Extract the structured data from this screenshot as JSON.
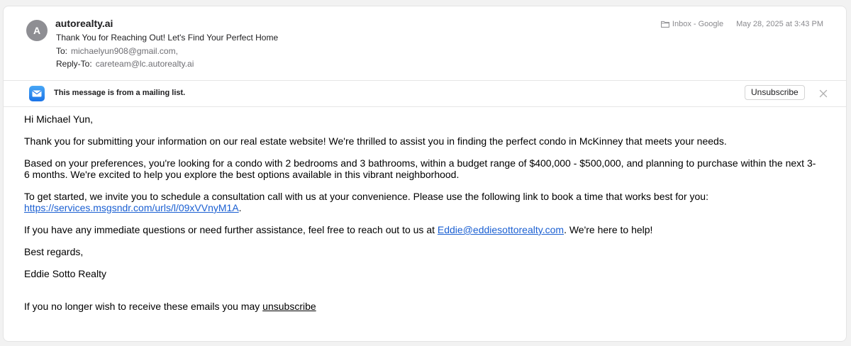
{
  "header": {
    "avatar_initial": "A",
    "sender": "autorealty.ai",
    "subject": "Thank You for Reaching Out! Let's Find Your Perfect Home",
    "to_label": "To:",
    "to_value": "michaelyun908@gmail.com,",
    "replyto_label": "Reply-To:",
    "replyto_value": "careteam@lc.autorealty.ai",
    "folder": "Inbox - Google",
    "date": "May 28, 2025 at 3:43 PM"
  },
  "banner": {
    "text": "This message is from a mailing list.",
    "unsubscribe_label": "Unsubscribe"
  },
  "body": {
    "greeting": "Hi Michael Yun,",
    "p1": "Thank you for submitting your information on our real estate website! We're thrilled to assist you in finding the perfect condo in McKinney that meets your needs.",
    "p2": "Based on your preferences, you're looking for a condo with 2 bedrooms and 3 bathrooms, within a budget range of $400,000 - $500,000, and planning to purchase within the next 3-6 months. We're excited to help you explore the best options available in this vibrant neighborhood.",
    "p3_text": "To get started, we invite you to schedule a consultation call with us at your convenience. Please use the following link to book a time that works best for you:",
    "p3_link": "https://services.msgsndr.com/urls/l/09xVVnyM1A",
    "p3_after": ".",
    "p4_before": "If you have any immediate questions or need further assistance, feel free to reach out to us at ",
    "p4_link": "Eddie@eddiesottorealty.com",
    "p4_after": ". We're here to help!",
    "closing": "Best regards,",
    "signature": "Eddie Sotto Realty"
  },
  "footer": {
    "text": "If you no longer wish to receive these emails you may ",
    "link": "unsubscribe"
  },
  "colors": {
    "link": "#1a5fd2",
    "avatar": "#8e8e93",
    "mail_icon": "#1a73e8"
  }
}
